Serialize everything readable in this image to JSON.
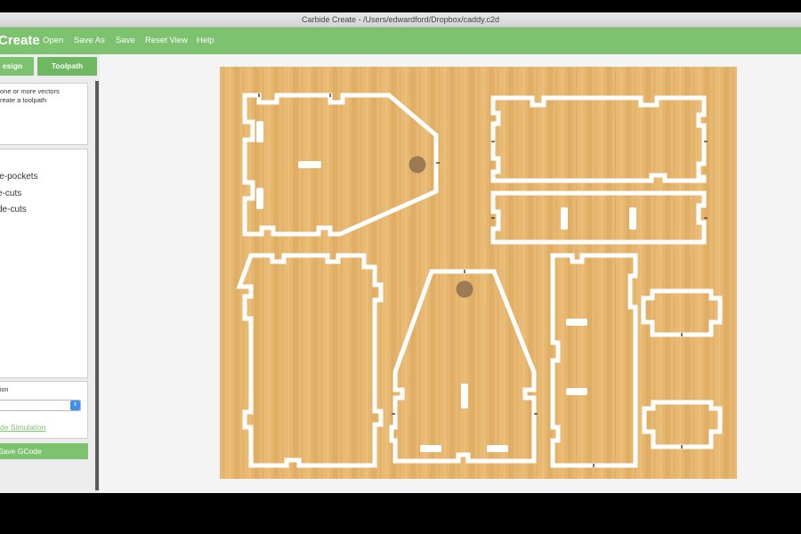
{
  "window": {
    "title": "Carbide Create - /Users/edwardford/Dropbox/caddy.c2d"
  },
  "menubar": {
    "logo": "Create",
    "items": [
      "Open",
      "Save As",
      "Save",
      "Reset View",
      "Help"
    ]
  },
  "sidebar": {
    "tabs": {
      "design": "esign",
      "toolpath": "Toolpath"
    },
    "help_text": [
      "one or more vectors",
      "reate a toolpath"
    ],
    "toolpaths": [
      "le-pockets",
      "e-cuts",
      "de-cuts"
    ],
    "simulation": {
      "label": "ion",
      "link": "de Simulation"
    },
    "save_gcode": "Save GCode"
  },
  "icons": {
    "select_arrow": "updown-chevron-icon"
  },
  "colors": {
    "accent_green": "#7cc26f",
    "wood": "#e2b069",
    "cut_lines": "#ffffff",
    "tool_marker": "#8a6e4e"
  }
}
